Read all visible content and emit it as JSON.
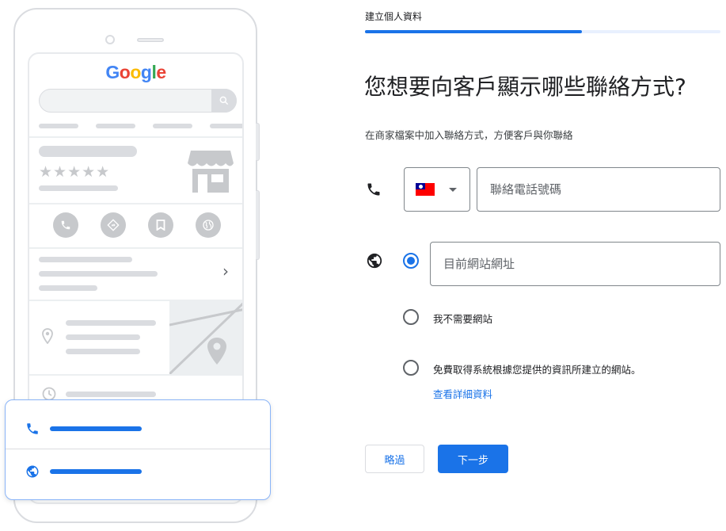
{
  "illustration": {
    "logo_letters": [
      {
        "ch": "G",
        "color": "#4285F4"
      },
      {
        "ch": "o",
        "color": "#EA4335"
      },
      {
        "ch": "o",
        "color": "#FBBC05"
      },
      {
        "ch": "g",
        "color": "#4285F4"
      },
      {
        "ch": "l",
        "color": "#34A853"
      },
      {
        "ch": "e",
        "color": "#EA4335"
      }
    ],
    "rating_stars": "★★★★★",
    "chevron": "›"
  },
  "header": {
    "step_label": "建立個人資料",
    "progress_fraction": 0.61
  },
  "main": {
    "heading": "您想要向客戶顯示哪些聯絡方式?",
    "subheading": "在商家檔案中加入聯絡方式，方便客戶與你聯絡",
    "phone": {
      "country": "Taiwan",
      "placeholder": "聯絡電話號碼"
    },
    "website": {
      "placeholder": "目前網站網址",
      "options": [
        {
          "label": "我不需要網站",
          "selected": false
        },
        {
          "label": "免費取得系統根據您提供的資訊所建立的網站。",
          "selected": false
        }
      ],
      "details_link": "查看詳細資料"
    }
  },
  "footer": {
    "skip_label": "略過",
    "next_label": "下一步"
  },
  "colors": {
    "accent": "#1a73e8",
    "illustration_gray": "#dadce0"
  }
}
